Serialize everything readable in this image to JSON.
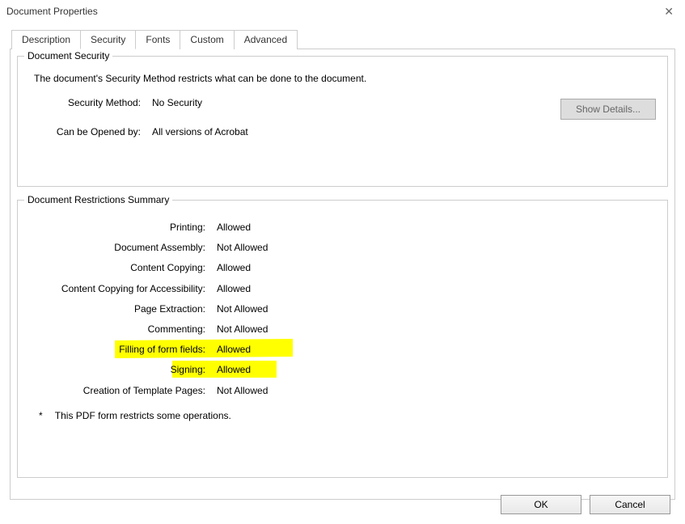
{
  "window": {
    "title": "Document Properties"
  },
  "tabs": [
    {
      "label": "Description"
    },
    {
      "label": "Security"
    },
    {
      "label": "Fonts"
    },
    {
      "label": "Custom"
    },
    {
      "label": "Advanced"
    }
  ],
  "security_section": {
    "legend": "Document Security",
    "description": "The document's Security Method restricts what can be done to the document.",
    "method_label": "Security Method:",
    "method_value": "No Security",
    "opened_by_label": "Can be Opened by:",
    "opened_by_value": "All versions of Acrobat",
    "show_details": "Show Details..."
  },
  "restrictions_section": {
    "legend": "Document Restrictions Summary",
    "rows": [
      {
        "label": "Printing:",
        "value": "Allowed"
      },
      {
        "label": "Document Assembly:",
        "value": "Not Allowed"
      },
      {
        "label": "Content Copying:",
        "value": "Allowed"
      },
      {
        "label": "Content Copying for Accessibility:",
        "value": "Allowed"
      },
      {
        "label": "Page Extraction:",
        "value": "Not Allowed"
      },
      {
        "label": "Commenting:",
        "value": "Not Allowed"
      },
      {
        "label": "Filling of form fields:",
        "value": "Allowed"
      },
      {
        "label": "Signing:",
        "value": "Allowed"
      },
      {
        "label": "Creation of Template Pages:",
        "value": "Not Allowed"
      }
    ],
    "footnote_marker": "*",
    "footnote": "This PDF form restricts some operations."
  },
  "buttons": {
    "ok": "OK",
    "cancel": "Cancel"
  }
}
